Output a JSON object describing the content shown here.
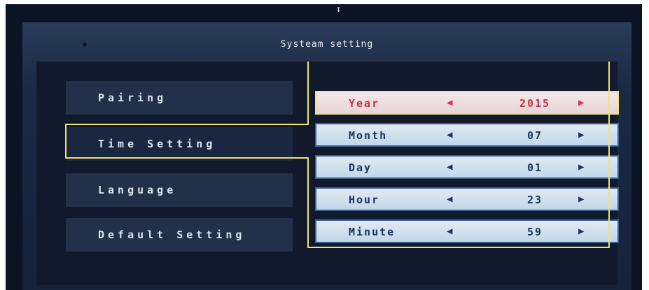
{
  "window": {
    "title": "Systeam setting"
  },
  "menu": {
    "items": [
      {
        "label": "Pairing"
      },
      {
        "label": "Time Setting"
      },
      {
        "label": "Language"
      },
      {
        "label": "Default Setting"
      }
    ],
    "selected_index": 1
  },
  "time_fields": [
    {
      "label": "Year",
      "value": "2015"
    },
    {
      "label": "Month",
      "value": "07"
    },
    {
      "label": "Day",
      "value": "01"
    },
    {
      "label": "Hour",
      "value": "23"
    },
    {
      "label": "Minute",
      "value": "59"
    }
  ],
  "active_field_index": 0,
  "icons": {
    "decrement": "left-arrow-icon",
    "increment": "right-arrow-icon"
  },
  "colors": {
    "highlight_outline": "#f2e36a",
    "active_text": "#c23545",
    "field_text": "#1c3559",
    "menu_text": "#dbe3ee"
  }
}
